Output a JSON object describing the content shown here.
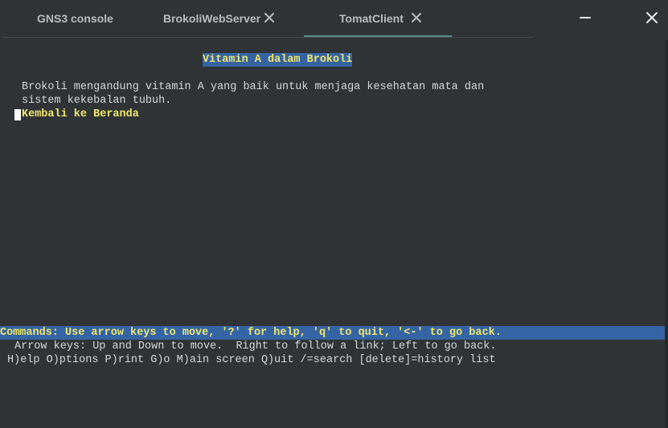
{
  "window": {
    "minimize_icon": "minimize-icon",
    "close_icon": "close-icon"
  },
  "tabs": [
    {
      "label": "GNS3 console",
      "closable": false,
      "active": false
    },
    {
      "label": "BrokoliWebServer",
      "closable": true,
      "active": false
    },
    {
      "label": "TomatClient",
      "closable": true,
      "active": true
    }
  ],
  "terminal": {
    "page_title": "Vitamin A dalam Brokoli",
    "body_line_1": "Brokoli mengandung vitamin A yang baik untuk menjaga kesehatan mata dan",
    "body_line_2": "sistem kekebalan tubuh.",
    "link_home": "Kembali ke Beranda",
    "commands_line": "Commands: Use arrow keys to move, '?' for help, 'q' to quit, '<-' to go back.",
    "help_line_1": "Arrow keys: Up and Down to move.  Right to follow a link; Left to go back.",
    "help_line_2": "H)elp O)ptions P)rint G)o M)ain screen Q)uit /=search [delete]=history list"
  },
  "colors": {
    "background": "#2f3336",
    "highlight_bg": "#3564a4",
    "highlight_text": "#f0e76a",
    "terminal_text": "#d7d7d7",
    "active_tab_underline": "#5b8a8f"
  }
}
